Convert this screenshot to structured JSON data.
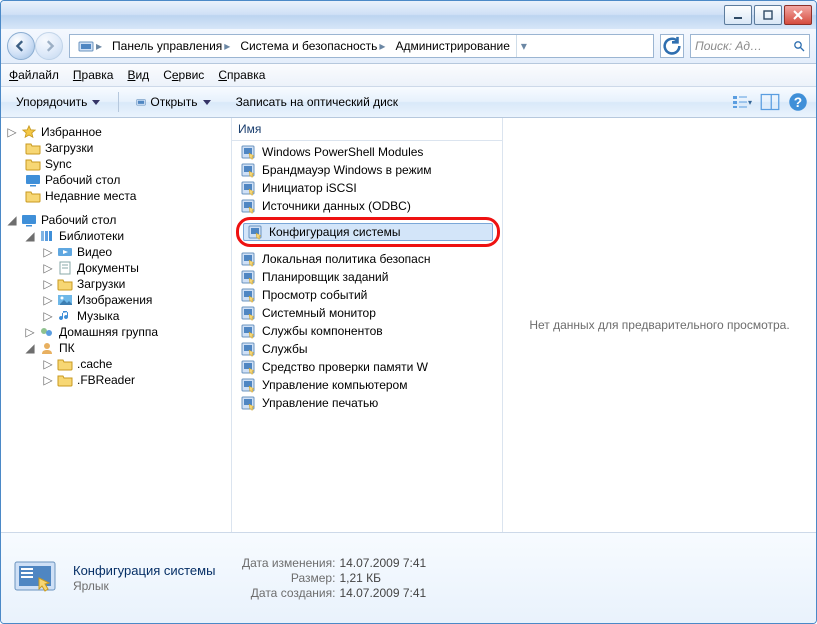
{
  "window": {
    "controls": {
      "min": "_",
      "max": "☐",
      "close": "×"
    }
  },
  "nav": {
    "root_icon": "computer-icon",
    "crumbs": [
      "Панель управления",
      "Система и безопасность",
      "Администрирование"
    ],
    "search_placeholder": "Поиск: Ад…"
  },
  "menu": [
    "Файл",
    "Правка",
    "Вид",
    "Сервис",
    "Справка"
  ],
  "toolbar": {
    "organize": "Упорядочить",
    "open": "Открыть",
    "burn": "Записать на оптический диск"
  },
  "tree": {
    "favorites": {
      "label": "Избранное",
      "items": [
        "Загрузки",
        "Sync",
        "Рабочий стол",
        "Недавние места"
      ]
    },
    "desktop": {
      "label": "Рабочий стол",
      "children": [
        {
          "label": "Библиотеки",
          "expanded": true,
          "children": [
            "Видео",
            "Документы",
            "Загрузки",
            "Изображения",
            "Музыка"
          ]
        },
        {
          "label": "Домашняя группа"
        },
        {
          "label": "ПК",
          "expanded": true,
          "children": [
            ".cache",
            ".FBReader"
          ]
        }
      ]
    }
  },
  "list": {
    "header": "Имя",
    "items": [
      "Windows PowerShell Modules",
      "Брандмауэр Windows в режим",
      "Инициатор iSCSI",
      "Источники данных (ODBC)",
      "Конфигурация системы",
      "Локальная политика безопасн",
      "Планировщик заданий",
      "Просмотр событий",
      "Системный монитор",
      "Службы компонентов",
      "Службы",
      "Средство проверки памяти W",
      "Управление компьютером",
      "Управление печатью"
    ],
    "selected_index": 4,
    "highlight_index": 4
  },
  "preview": {
    "text": "Нет данных для предварительного просмотра."
  },
  "details": {
    "title": "Конфигурация системы",
    "subtitle": "Ярлык",
    "props": [
      {
        "label": "Дата изменения:",
        "value": "14.07.2009 7:41"
      },
      {
        "label": "Размер:",
        "value": "1,21 КБ"
      },
      {
        "label": "Дата создания:",
        "value": "14.07.2009 7:41"
      }
    ]
  }
}
